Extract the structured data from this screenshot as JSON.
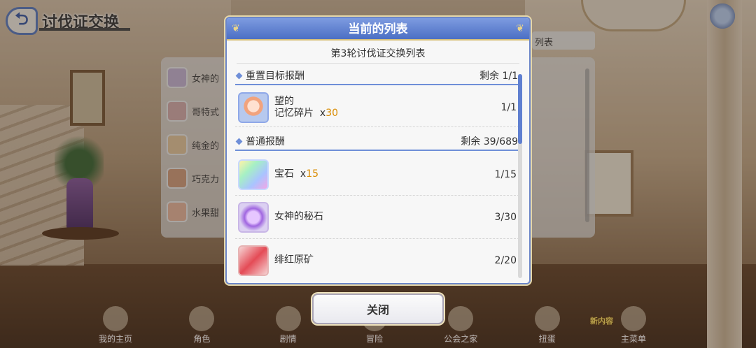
{
  "page": {
    "title": "讨伐证交换",
    "back_tab_label": "列表",
    "back_list": [
      "女神的",
      "哥特式",
      "纯金的",
      "巧克力",
      "水果甜"
    ]
  },
  "modal": {
    "title": "当前的列表",
    "subtitle": "第3轮讨伐证交换列表",
    "sections": [
      {
        "label": "重置目标报酬",
        "remaining": "剩余 1/1",
        "items": [
          {
            "name_line1": "望的",
            "name_line2": "记忆碎片",
            "qty_prefix": "x",
            "qty": "30",
            "count": "1/1",
            "icon": "memory-fragment-icon"
          }
        ]
      },
      {
        "label": "普通报酬",
        "remaining": "剩余 39/689",
        "items": [
          {
            "name_line1": "宝石",
            "qty_prefix": "x",
            "qty": "15",
            "count": "1/15",
            "icon": "gem-icon"
          },
          {
            "name_line1": "女神的秘石",
            "count": "3/30",
            "icon": "goddess-stone-icon"
          },
          {
            "name_line1": "绯红原矿",
            "count": "2/20",
            "icon": "crimson-ore-icon"
          }
        ]
      }
    ],
    "close_label": "关闭"
  },
  "nav": {
    "items": [
      "我的主页",
      "角色",
      "剧情",
      "冒险",
      "公会之家",
      "扭蛋",
      "主菜单"
    ],
    "new_badge": "新内容"
  },
  "colors": {
    "accent": "#5f7fd0",
    "qty": "#d98b00",
    "header": "#4c6fc4"
  }
}
